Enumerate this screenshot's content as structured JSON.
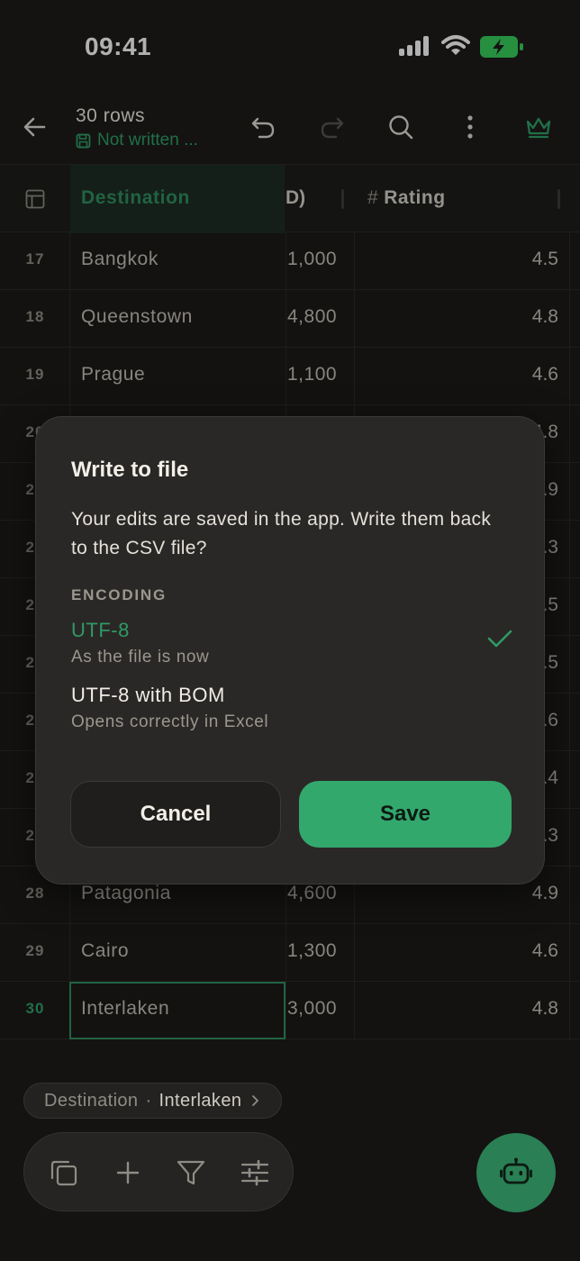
{
  "status": {
    "time": "09:41"
  },
  "appbar": {
    "title": "30 rows",
    "subtitle": "Not written ..."
  },
  "header": {
    "destination": "Destination",
    "cost_partial": "D)",
    "rating": "Rating",
    "rating_prefix": "#"
  },
  "rows": [
    {
      "num": "17",
      "dest": "Bangkok",
      "cost": "1,000",
      "rating": "4.5"
    },
    {
      "num": "18",
      "dest": "Queenstown",
      "cost": "4,800",
      "rating": "4.8"
    },
    {
      "num": "19",
      "dest": "Prague",
      "cost": "1,100",
      "rating": "4.6"
    },
    {
      "num": "20",
      "dest": "",
      "cost": "",
      "rating": "4.8"
    },
    {
      "num": "21",
      "dest": "",
      "cost": "",
      "rating": "4.9"
    },
    {
      "num": "22",
      "dest": "",
      "cost": "",
      "rating": "4.3"
    },
    {
      "num": "23",
      "dest": "",
      "cost": "",
      "rating": "4.5"
    },
    {
      "num": "24",
      "dest": "",
      "cost": "",
      "rating": "4.5"
    },
    {
      "num": "25",
      "dest": "",
      "cost": "",
      "rating": "4.6"
    },
    {
      "num": "26",
      "dest": "",
      "cost": "",
      "rating": "4.4"
    },
    {
      "num": "27",
      "dest": "",
      "cost": "",
      "rating": "4.3"
    },
    {
      "num": "28",
      "dest": "Patagonia",
      "cost": "4,600",
      "rating": "4.9"
    },
    {
      "num": "29",
      "dest": "Cairo",
      "cost": "1,300",
      "rating": "4.6"
    },
    {
      "num": "30",
      "dest": "Interlaken",
      "cost": "3,000",
      "rating": "4.8"
    }
  ],
  "dialog": {
    "title": "Write to file",
    "message": "Your edits are saved in the app. Write them back to the CSV file?",
    "encoding_label": "ENCODING",
    "options": [
      {
        "title": "UTF-8",
        "subtitle": "As the file is now",
        "selected": true
      },
      {
        "title": "UTF-8 with BOM",
        "subtitle": "Opens correctly in Excel",
        "selected": false
      }
    ],
    "cancel": "Cancel",
    "save": "Save"
  },
  "breadcrumb": {
    "column": "Destination",
    "separator": "·",
    "value": "Interlaken"
  },
  "colors": {
    "accent": "#33a86d",
    "accent_text": "#2f9a64",
    "background": "#1c1b19",
    "dialog": "#2a2826"
  }
}
